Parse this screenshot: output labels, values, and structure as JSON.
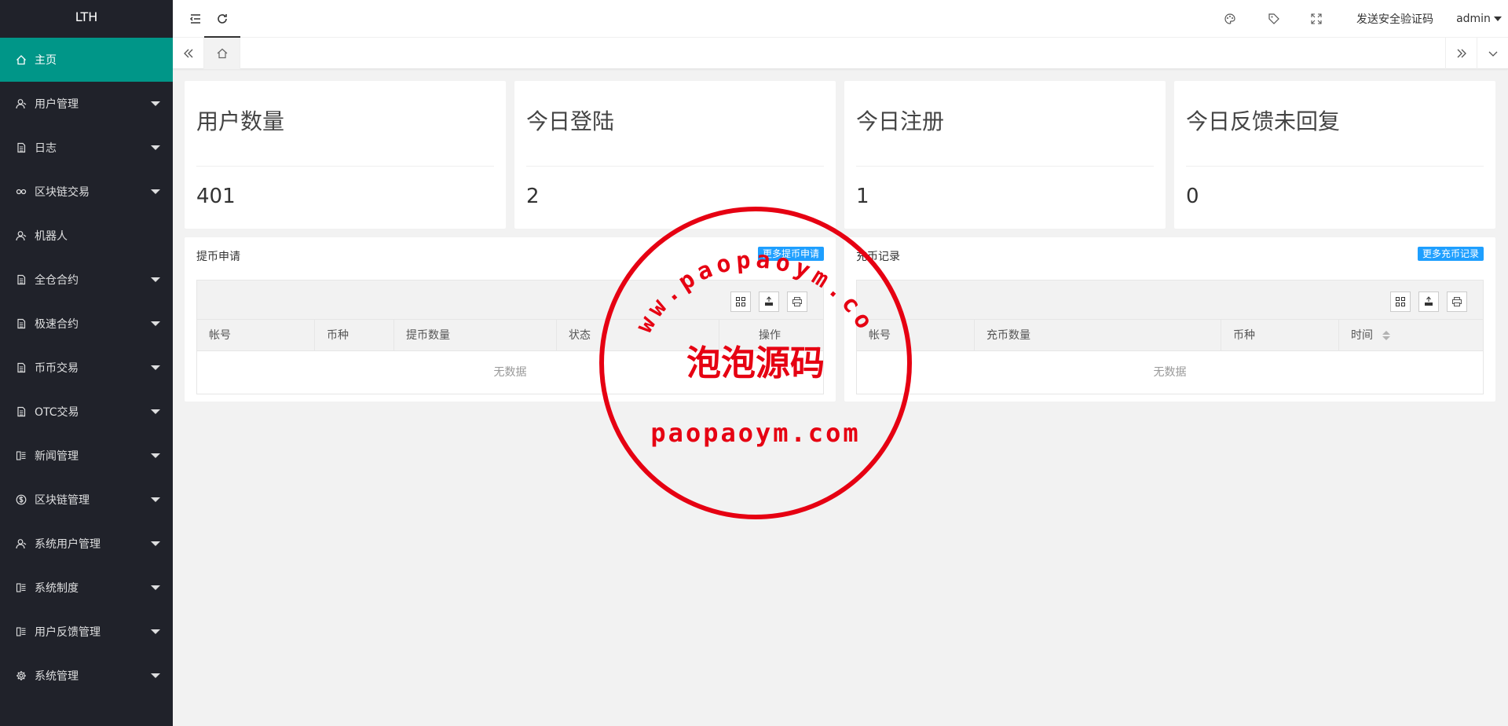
{
  "sidebar": {
    "logo": "LTH",
    "items": [
      {
        "label": "主页",
        "icon": "home-icon",
        "active": true,
        "has_children": false
      },
      {
        "label": "用户管理",
        "icon": "user-icon",
        "has_children": true
      },
      {
        "label": "日志",
        "icon": "document-icon",
        "has_children": true
      },
      {
        "label": "区块链交易",
        "icon": "link-icon",
        "has_children": true
      },
      {
        "label": "机器人",
        "icon": "user-icon",
        "has_children": false
      },
      {
        "label": "全仓合约",
        "icon": "document-icon",
        "has_children": true
      },
      {
        "label": "极速合约",
        "icon": "document-icon",
        "has_children": true
      },
      {
        "label": "币币交易",
        "icon": "document-icon",
        "has_children": true
      },
      {
        "label": "OTC交易",
        "icon": "document-icon",
        "has_children": true
      },
      {
        "label": "新闻管理",
        "icon": "news-icon",
        "has_children": true
      },
      {
        "label": "区块链管理",
        "icon": "dollar-icon",
        "has_children": true
      },
      {
        "label": "系统用户管理",
        "icon": "user-icon",
        "has_children": true
      },
      {
        "label": "系统制度",
        "icon": "news-icon",
        "has_children": true
      },
      {
        "label": "用户反馈管理",
        "icon": "news-icon",
        "has_children": true
      },
      {
        "label": "系统管理",
        "icon": "gear-icon",
        "has_children": true
      }
    ]
  },
  "header": {
    "send_code_label": "发送安全验证码",
    "user_label": "admin"
  },
  "stats": [
    {
      "title": "用户数量",
      "value": "401"
    },
    {
      "title": "今日登陆",
      "value": "2"
    },
    {
      "title": "今日注册",
      "value": "1"
    },
    {
      "title": "今日反馈未回复",
      "value": "0"
    }
  ],
  "withdraw_panel": {
    "title": "提币申请",
    "more_label": "更多提币申请",
    "columns": [
      "帐号",
      "币种",
      "提币数量",
      "状态",
      "操作"
    ],
    "empty_text": "无数据"
  },
  "deposit_panel": {
    "title": "充币记录",
    "more_label": "更多充币记录",
    "columns": [
      "帐号",
      "充币数量",
      "币种",
      "时间"
    ],
    "empty_text": "无数据"
  },
  "watermark": {
    "arc_text": "www.paopaoym.com",
    "center_text": "泡泡源码",
    "bottom_text": "paopaoym.com"
  },
  "colors": {
    "sidebar_bg": "#20222a",
    "active_menu": "#009688",
    "button_blue": "#1e9fff",
    "stamp_red": "#e60012"
  }
}
